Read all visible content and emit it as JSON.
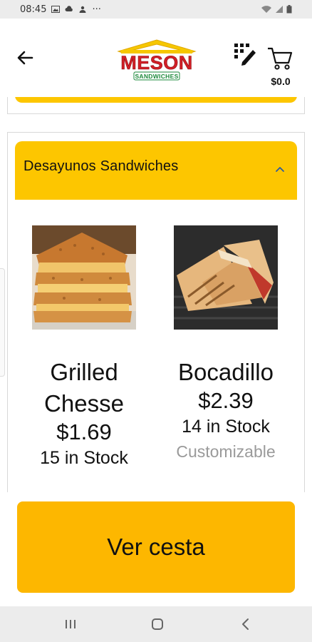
{
  "status_bar": {
    "time": "08:45",
    "more_indicator": "···",
    "left_icons": [
      "image-icon",
      "cloud-icon",
      "person-icon"
    ],
    "right_icons": [
      "wifi-icon",
      "signal-icon",
      "battery-icon"
    ]
  },
  "header": {
    "logo": {
      "word": "MESON",
      "sub": "SANDWICHES"
    },
    "cart_total": "$0.0"
  },
  "section": {
    "title": "Desayunos Sandwiches",
    "expanded": true,
    "products": [
      {
        "name_line1": "Grilled",
        "name_line2": "Chesse",
        "price": "$1.69",
        "stock": "15 in Stock",
        "customizable": ""
      },
      {
        "name_line1": "Bocadillo",
        "name_line2": "",
        "price": "$2.39",
        "stock": "14 in Stock",
        "customizable": "Customizable"
      }
    ]
  },
  "cart_button": {
    "label": "Ver cesta"
  },
  "colors": {
    "accent_yellow": "#fdc600",
    "cart_button": "#fdb700",
    "logo_red": "#d21f26",
    "logo_green": "#1e8a3c",
    "muted_text": "#9a9a9a"
  }
}
